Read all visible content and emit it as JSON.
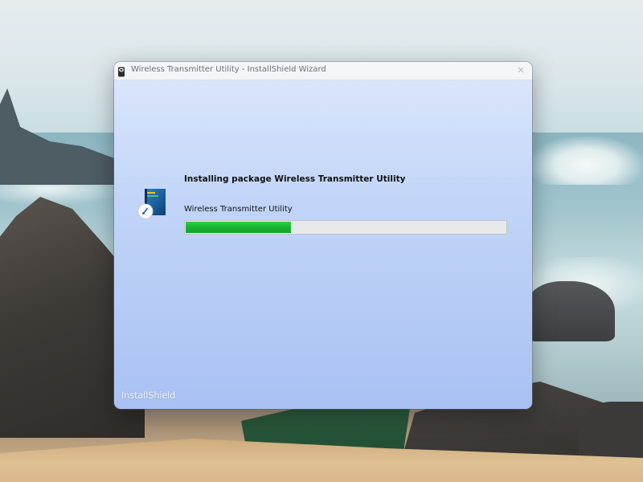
{
  "window": {
    "title": "Wireless Transmitter Utility - InstallShield Wizard",
    "close_symbol": "✕"
  },
  "main": {
    "heading": "Installing package Wireless Transmitter Utility",
    "component_label": "Wireless Transmitter Utility",
    "progress_fraction": 0.33,
    "progress_color": "#18b233",
    "icon": "package-install-icon"
  },
  "footer": {
    "brand": "InstallShield"
  },
  "colors": {
    "dialog_bg_top": "#dde8fb",
    "dialog_bg_bottom": "#a9c1f3"
  }
}
